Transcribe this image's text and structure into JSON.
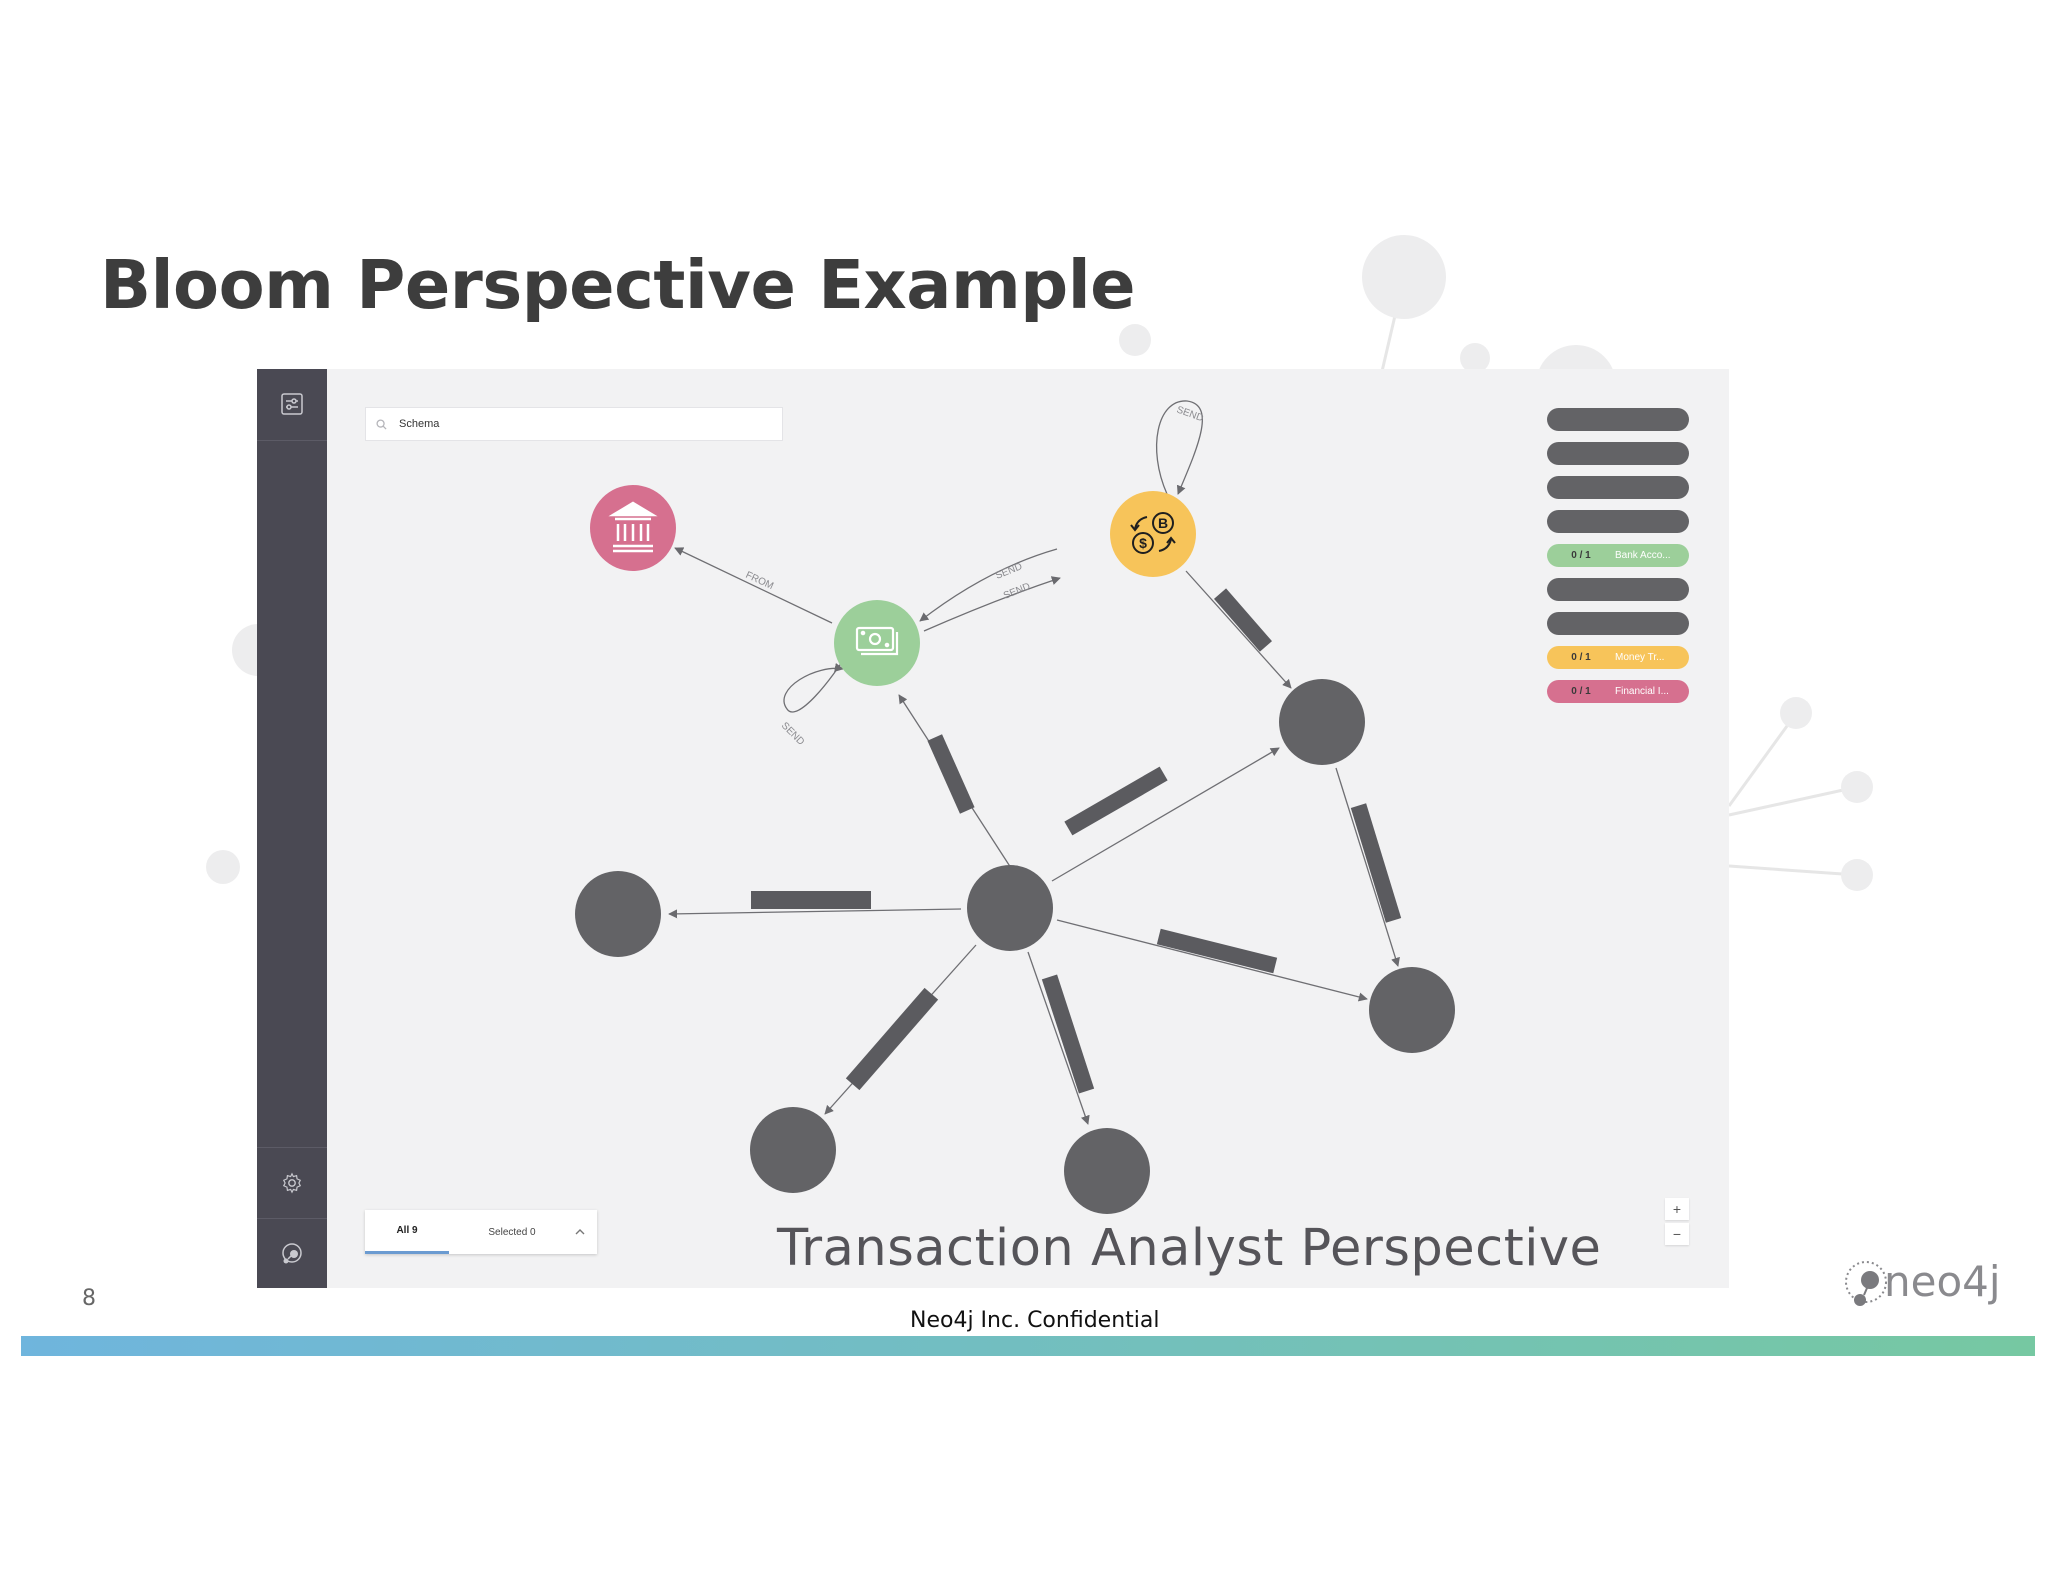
{
  "slide": {
    "title": "Bloom Perspective Example",
    "page_number": "8",
    "confidential": "Neo4j Inc. Confidential",
    "logo_text": "neo4j"
  },
  "app": {
    "search": {
      "value": "Schema",
      "icon": "search-icon"
    },
    "sidebar": {
      "top_icon": "perspective-icon",
      "bottom_icons": [
        "gear-icon",
        "neo4j-brain-icon"
      ]
    },
    "legend": [
      {
        "color": "#636366",
        "count": "",
        "label": ""
      },
      {
        "color": "#636366",
        "count": "",
        "label": ""
      },
      {
        "color": "#636366",
        "count": "",
        "label": ""
      },
      {
        "color": "#636366",
        "count": "",
        "label": ""
      },
      {
        "color": "#9ccf9a",
        "count": "0 / 1",
        "label": "Bank Acco..."
      },
      {
        "color": "#636366",
        "count": "",
        "label": ""
      },
      {
        "color": "#636366",
        "count": "",
        "label": ""
      },
      {
        "color": "#f7c45a",
        "count": "0 / 1",
        "label": "Money Tr..."
      },
      {
        "color": "#d6708f",
        "count": "0 / 1",
        "label": "Financial I..."
      }
    ],
    "bottom_panel": {
      "all_tab": "All 9",
      "selected_tab": "Selected 0"
    },
    "zoom": {
      "in": "+",
      "out": "−"
    },
    "caption": "Transaction Analyst Perspective",
    "graph": {
      "nodes": [
        {
          "id": "financial-institution",
          "type": "Financial Institution",
          "color": "#d6708f",
          "icon": "bank-icon"
        },
        {
          "id": "bank-account",
          "type": "Bank Account",
          "color": "#9ccf9a",
          "icon": "money-icon"
        },
        {
          "id": "money-transfer",
          "type": "Money Transfer",
          "color": "#f7c45a",
          "icon": "currency-exchange-icon"
        },
        {
          "id": "gray-node-1",
          "color": "#636366"
        },
        {
          "id": "gray-node-2",
          "color": "#636366"
        },
        {
          "id": "gray-node-3",
          "color": "#636366"
        },
        {
          "id": "gray-node-4",
          "color": "#636366"
        },
        {
          "id": "gray-node-5",
          "color": "#636366"
        },
        {
          "id": "gray-node-6",
          "color": "#636366"
        }
      ],
      "relationships": [
        {
          "from": "bank-account",
          "to": "financial-institution",
          "label": "FROM"
        },
        {
          "from": "money-transfer",
          "to": "bank-account",
          "label": "SEND"
        },
        {
          "from": "bank-account",
          "to": "money-transfer",
          "label": "SEND"
        },
        {
          "from": "money-transfer",
          "to": "money-transfer",
          "label": "SEND"
        },
        {
          "from": "bank-account",
          "to": "bank-account",
          "label": "SEND"
        }
      ]
    }
  }
}
